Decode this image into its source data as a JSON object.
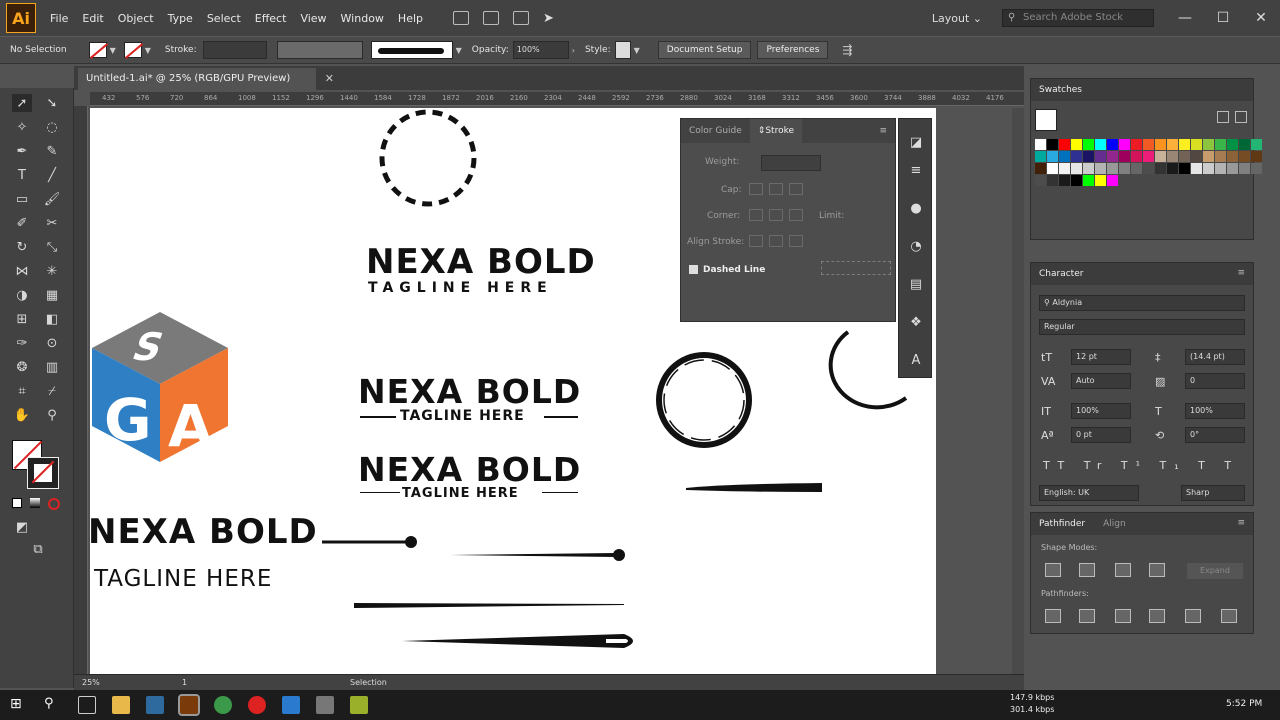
{
  "app": {
    "logo": "Ai",
    "menu": [
      "File",
      "Edit",
      "Object",
      "Type",
      "Select",
      "Effect",
      "View",
      "Window",
      "Help"
    ],
    "workspace": "Layout",
    "search_placeholder": "Search Adobe Stock"
  },
  "control_bar": {
    "selection": "No Selection",
    "stroke_label": "Stroke:",
    "opacity_label": "Opacity:",
    "opacity_value": "100%",
    "style_label": "Style:",
    "document_setup": "Document Setup",
    "preferences": "Preferences"
  },
  "document": {
    "tab_title": "Untitled-1.ai* @ 25% (RGB/GPU Preview)"
  },
  "ruler_ticks": [
    "432",
    "576",
    "720",
    "864",
    "1008",
    "1152",
    "1296",
    "1440",
    "1584",
    "1728",
    "1872",
    "2016",
    "2160",
    "2304",
    "2448",
    "2592",
    "2736",
    "2880",
    "3024",
    "3168",
    "3312",
    "3456",
    "3600",
    "3744",
    "3888",
    "4032",
    "4176"
  ],
  "canvas": {
    "logo1_title": "NEXA BOLD",
    "logo1_tag": "TAGLINE HERE",
    "logo2_title": "NEXA BOLD",
    "logo2_tag": "TAGLINE HERE",
    "logo3_title": "NEXA BOLD",
    "logo3_tag": "TAGLINE HERE",
    "logo4_title": "NEXA BOLD",
    "logo4_tag": "TAGLINE HERE",
    "cube_letters": [
      "S",
      "G",
      "A"
    ]
  },
  "stroke_panel": {
    "tab_color_guide": "Color Guide",
    "tab_stroke": "Stroke",
    "weight_label": "Weight:",
    "cap_label": "Cap:",
    "corner_label": "Corner:",
    "limit_label": "Limit:",
    "align_label": "Align Stroke:",
    "dashed_label": "Dashed Line"
  },
  "swatches": {
    "title": "Swatches",
    "colors": [
      "#ffffff",
      "#000000",
      "#ff0000",
      "#ffff00",
      "#00ff00",
      "#00ffff",
      "#0000ff",
      "#ff00ff",
      "#ed1c24",
      "#f15a24",
      "#f7931e",
      "#fbb03b",
      "#fcee21",
      "#d9e021",
      "#8cc63f",
      "#39b54a",
      "#009245",
      "#006837",
      "#22b573",
      "#00a99d",
      "#29abe2",
      "#0071bc",
      "#2e3192",
      "#1b1464",
      "#662d91",
      "#93278f",
      "#9e005d",
      "#d4145a",
      "#ed1e79",
      "#c7b299",
      "#998675",
      "#736357",
      "#534741",
      "#c69c6d",
      "#a67c52",
      "#8c6239",
      "#754c24",
      "#603813",
      "#42210b",
      "#ffffff",
      "#f2f2f2",
      "#e6e6e6",
      "#cccccc",
      "#b3b3b3",
      "#999999",
      "#808080",
      "#666666",
      "#4d4d4d",
      "#333333",
      "#1a1a1a",
      "#000000",
      "#e6e6e6",
      "#cccccc",
      "#b3b3b3",
      "#999999",
      "#808080",
      "#666666",
      "#4d4d4d",
      "#333333",
      "#1a1a1a",
      "#000000",
      "#00ff00",
      "#ffff00",
      "#ff00ff"
    ]
  },
  "character": {
    "title": "Character",
    "font_family": "Aldynia",
    "font_style": "Regular",
    "size": "12 pt",
    "leading": "(14.4 pt)",
    "kerning": "Auto",
    "tracking": "0",
    "vscale": "100%",
    "hscale": "100%",
    "baseline": "0 pt",
    "rotation": "0°",
    "language": "English: UK",
    "aa": "Sharp"
  },
  "pathfinder": {
    "tab_pathfinder": "Pathfinder",
    "tab_align": "Align",
    "shape_modes": "Shape Modes:",
    "pathfinders": "Pathfinders:",
    "expand": "Expand"
  },
  "status": {
    "zoom": "25%",
    "page": "1",
    "tool": "Selection"
  },
  "taskbar": {
    "upload": "147.9 kbps",
    "download": "301.4 kbps",
    "time": "5:52 PM"
  }
}
